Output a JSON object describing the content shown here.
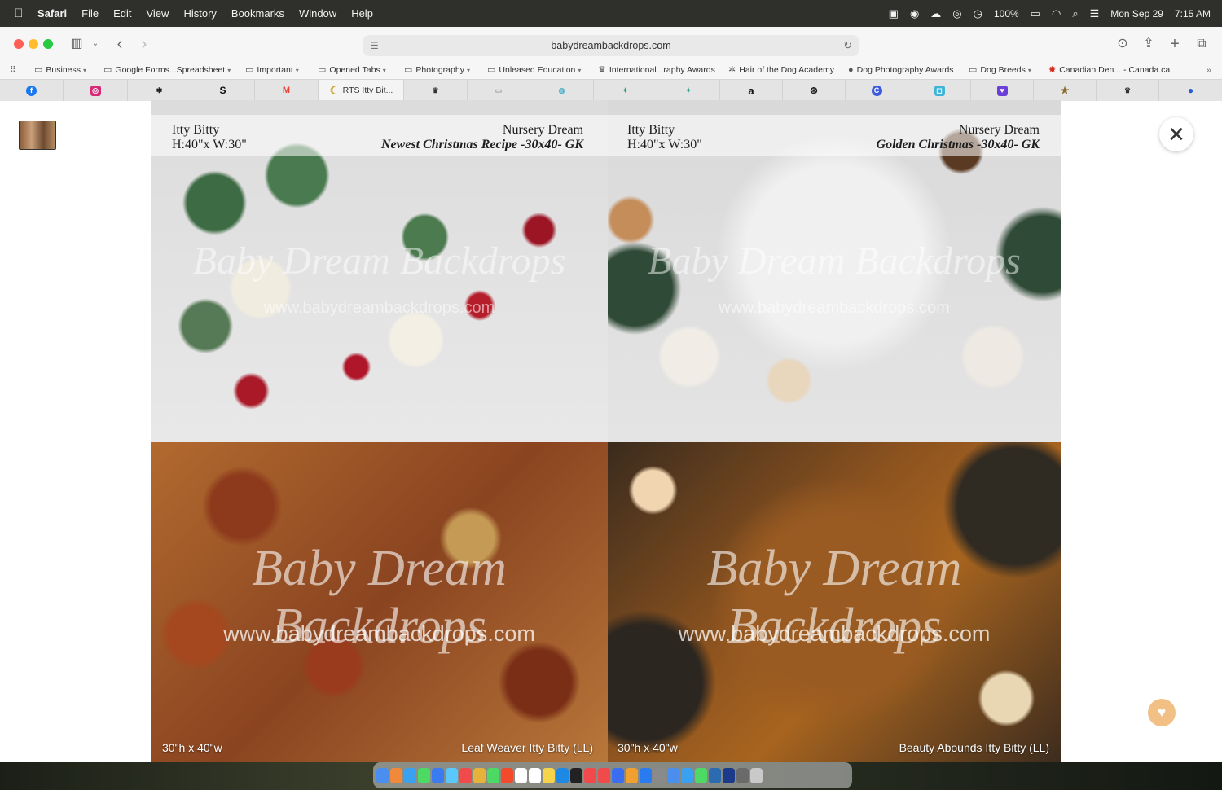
{
  "menubar": {
    "app_name": "Safari",
    "items": [
      "File",
      "Edit",
      "View",
      "History",
      "Bookmarks",
      "Window",
      "Help"
    ],
    "status": {
      "battery": "100%",
      "date": "Mon Sep 29",
      "time": "7:15 AM"
    }
  },
  "toolbar": {
    "url": "babydreambackdrops.com"
  },
  "bookmarks": [
    {
      "label": "Business",
      "icon": "folder-icon",
      "menu": true
    },
    {
      "label": "Google Forms...Spreadsheet",
      "icon": "folder-icon",
      "menu": true
    },
    {
      "label": "Important",
      "icon": "folder-icon",
      "menu": true
    },
    {
      "label": "Opened Tabs",
      "icon": "folder-icon",
      "menu": true
    },
    {
      "label": "Photography",
      "icon": "folder-icon",
      "menu": true
    },
    {
      "label": "Unleased Education",
      "icon": "folder-icon",
      "menu": true
    },
    {
      "label": "International...raphy Awards",
      "icon": "trophy-icon",
      "menu": false
    },
    {
      "label": "Hair of the Dog Academy",
      "icon": "dog-icon",
      "menu": false
    },
    {
      "label": "Dog Photography Awards",
      "icon": "globe-icon",
      "menu": false
    },
    {
      "label": "Dog Breeds",
      "icon": "folder-icon",
      "menu": true
    },
    {
      "label": "Canadian Den... - Canada.ca",
      "icon": "maple-leaf-icon",
      "menu": false
    }
  ],
  "tabs": [
    {
      "glyph": "f",
      "icon": "facebook-icon",
      "color": "#1877f2"
    },
    {
      "glyph": "◎",
      "icon": "instagram-icon",
      "color": "#d62976"
    },
    {
      "glyph": "✱",
      "icon": "paw-icon",
      "color": "#222222"
    },
    {
      "glyph": "S",
      "icon": "s-logo-icon",
      "color": "#111111"
    },
    {
      "glyph": "M",
      "icon": "gmail-icon",
      "color": "#ea4335"
    },
    {
      "glyph": "☾",
      "icon": "moon-icon",
      "color": "#c9a227",
      "title": "RTS Itty Bit..."
    },
    {
      "glyph": "♛",
      "icon": "trophy-icon",
      "color": "#333333"
    },
    {
      "glyph": "▭",
      "icon": "image-icon",
      "color": "#9a9a9a"
    },
    {
      "glyph": "◍",
      "icon": "circle-logo-icon",
      "color": "#4fb3c8"
    },
    {
      "glyph": "✦",
      "icon": "leaf-logo-icon",
      "color": "#2f9e88"
    },
    {
      "glyph": "✦",
      "icon": "leaf-logo-icon",
      "color": "#2f9e88"
    },
    {
      "glyph": "a",
      "icon": "amazon-icon",
      "color": "#111111"
    },
    {
      "glyph": "⊛",
      "icon": "openai-icon",
      "color": "#222222"
    },
    {
      "glyph": "C",
      "icon": "c-logo-icon",
      "color": "#3b5bdb"
    },
    {
      "glyph": "◻",
      "icon": "frame-icon",
      "color": "#3fb4d8"
    },
    {
      "glyph": "♥",
      "icon": "heart-chat-icon",
      "color": "#6c3fd8"
    },
    {
      "glyph": "★",
      "icon": "star-icon",
      "color": "#8a6d2b"
    },
    {
      "glyph": "♛",
      "icon": "trophy-icon",
      "color": "#333333"
    },
    {
      "glyph": "●",
      "icon": "blue-orb-icon",
      "color": "#2a5bd7"
    }
  ],
  "panels": [
    {
      "label_left_1": "Itty Bitty",
      "label_left_2": "H:40\"x W:30\"",
      "label_right_1": "Nursery Dream",
      "label_right_2": "Newest Christmas Recipe -30x40- GK",
      "watermark": "Baby Dream Backdrops",
      "watermark_url": "www.babydreambackdrops.com"
    },
    {
      "label_left_1": "Itty Bitty",
      "label_left_2": "H:40\"x W:30\"",
      "label_right_1": "Nursery Dream",
      "label_right_2": "Golden Christmas -30x40- GK",
      "watermark": "Baby Dream Backdrops",
      "watermark_url": "www.babydreambackdrops.com"
    },
    {
      "size": "30\"h x 40\"w",
      "name": "Leaf Weaver Itty Bitty (LL)",
      "watermark": "Baby Dream Backdrops",
      "watermark_url": "www.babydreambackdrops.com"
    },
    {
      "size": "30\"h x 40\"w",
      "name": "Beauty Abounds Itty Bitty (LL)",
      "watermark": "Baby Dream Backdrops",
      "watermark_url": "www.babydreambackdrops.com"
    }
  ],
  "dock_colors": [
    "#4a8ef0",
    "#f08a3a",
    "#3aa0f0",
    "#4cd964",
    "#3b7bf0",
    "#5ac8fa",
    "#f04a4a",
    "#e6b33a",
    "#4cd964",
    "#f24a2a",
    "#ffffff",
    "#ffffff",
    "#f6d44a",
    "#1e88e5",
    "#222222",
    "#f24a4a",
    "#f04a4a",
    "#3a6df0",
    "#f0a030",
    "#2a7af0",
    "#8a8a8a",
    "#4a8ef0",
    "#3aa0f0",
    "#4cd964",
    "#2b6cb0",
    "#1b3a8a",
    "#6a6a6a",
    "#c9c9c9"
  ]
}
